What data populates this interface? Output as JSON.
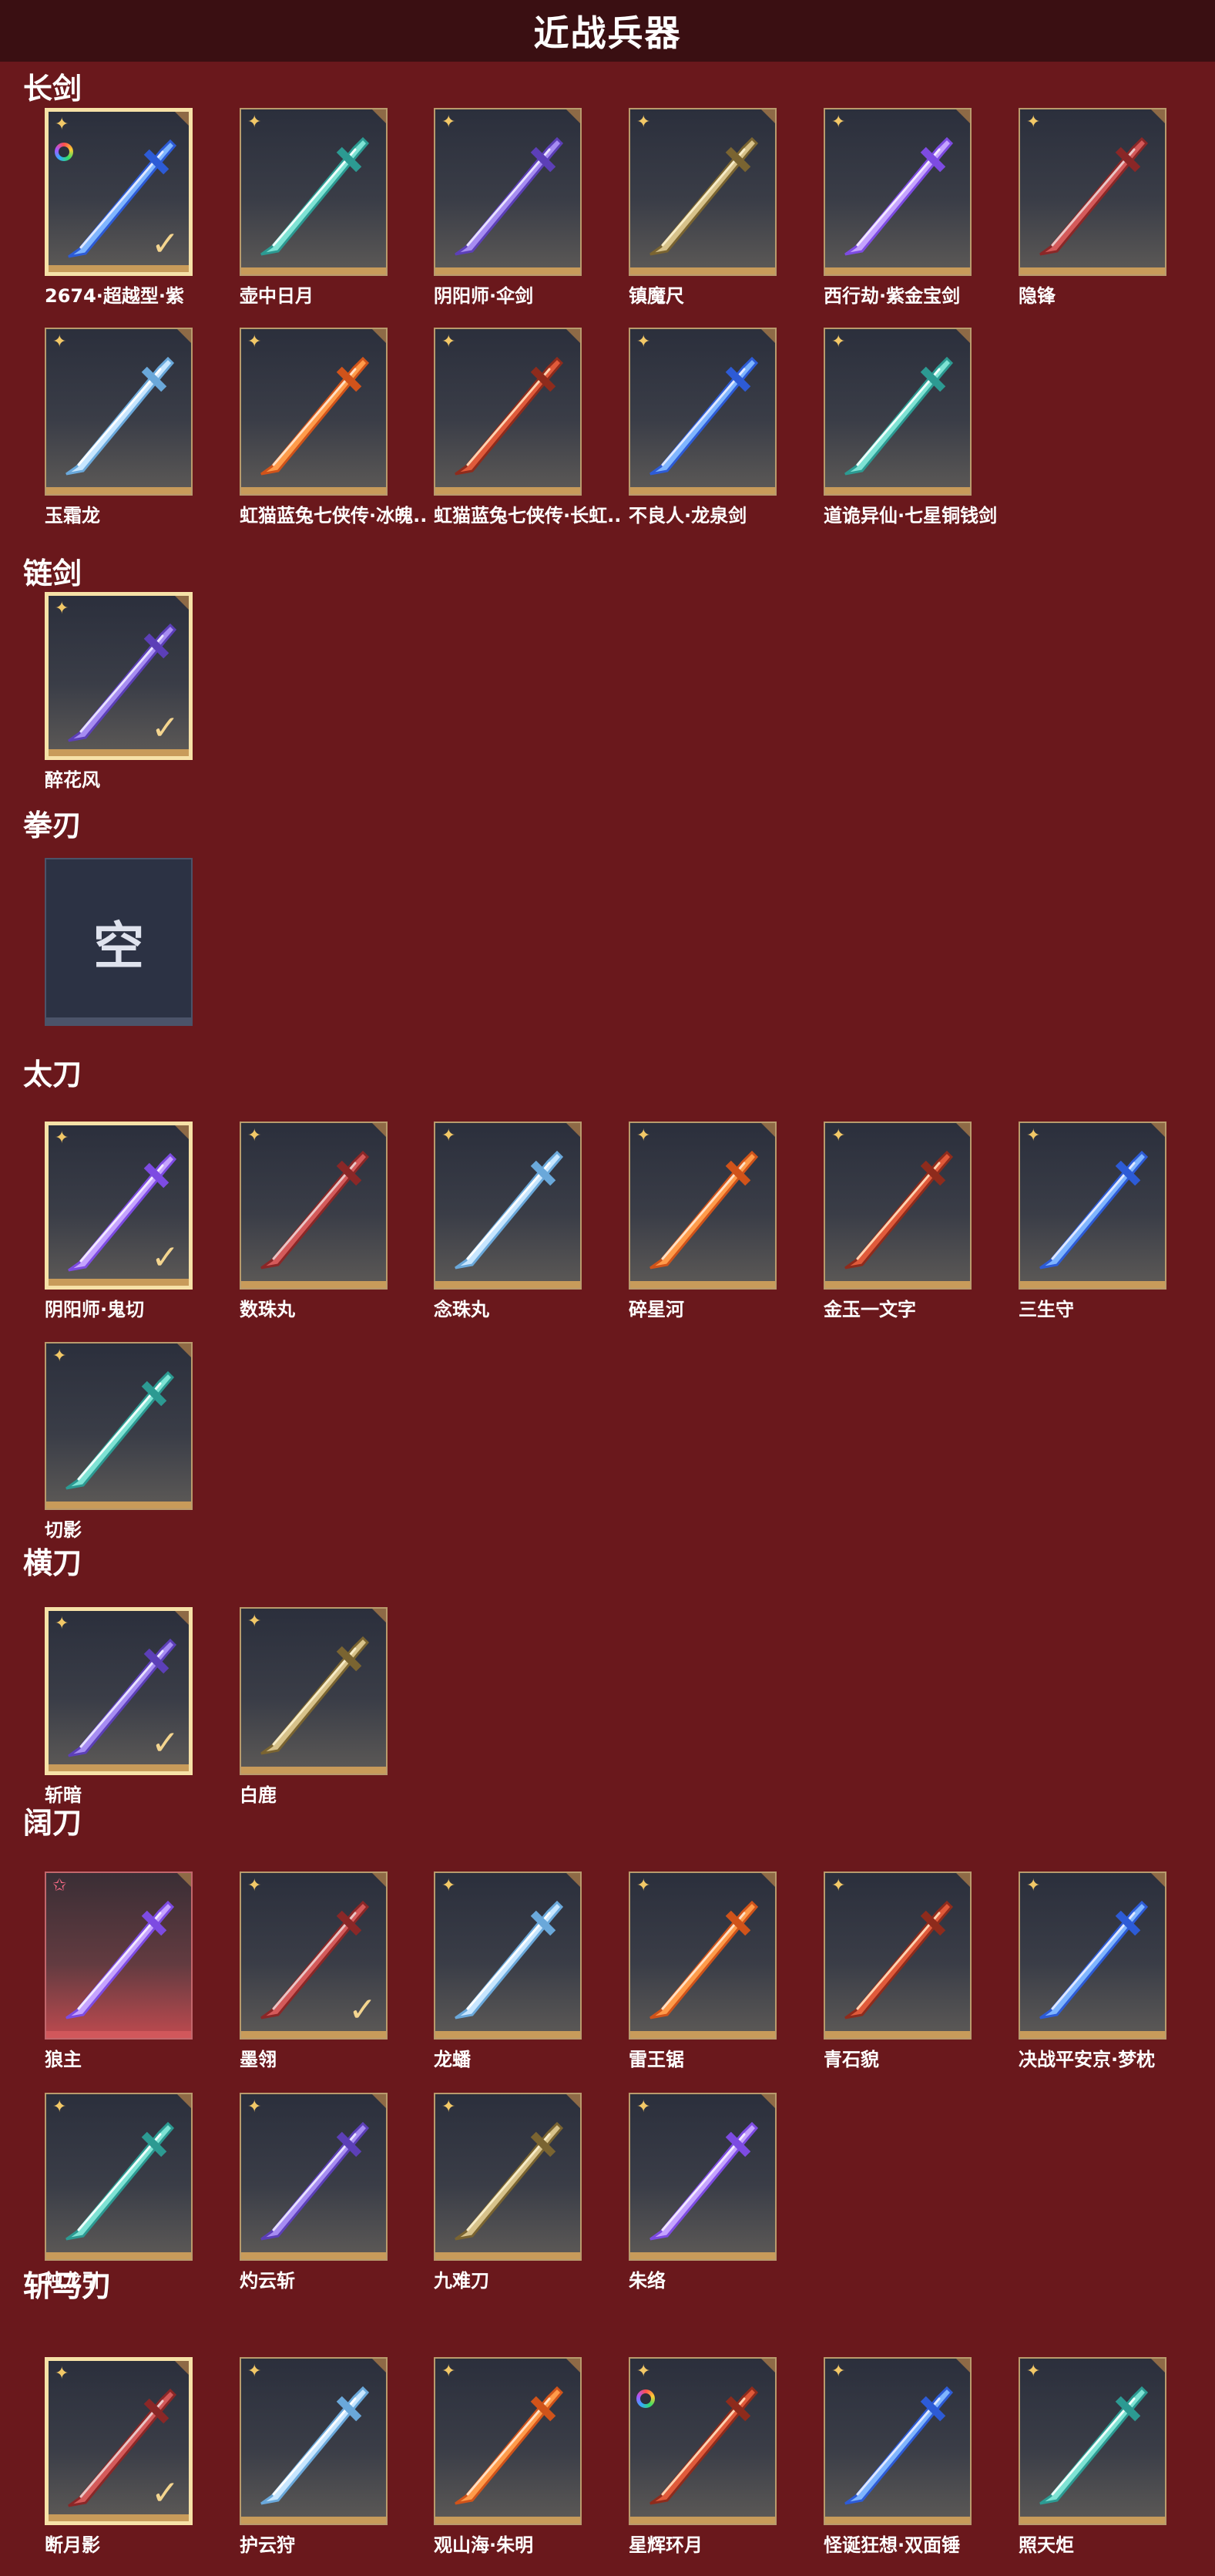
{
  "page": {
    "title": "近战兵器"
  },
  "sections": [
    {
      "name": "长剑",
      "items": [
        {
          "label": "2674·超越型·紫",
          "selected": true,
          "ring": true,
          "rarity": "gold"
        },
        {
          "label": "壶中日月",
          "selected": false,
          "rarity": "gold"
        },
        {
          "label": "阴阳师·伞剑",
          "selected": false,
          "rarity": "gold"
        },
        {
          "label": "镇魔尺",
          "selected": false,
          "rarity": "gold"
        },
        {
          "label": "西行劫·紫金宝剑",
          "selected": false,
          "rarity": "gold"
        },
        {
          "label": "隐锋",
          "selected": false,
          "rarity": "gold"
        },
        {
          "label": "玉霜龙",
          "selected": false,
          "rarity": "gold"
        },
        {
          "label": "虹猫蓝兔七侠传·冰魄..",
          "selected": false,
          "rarity": "gold"
        },
        {
          "label": "虹猫蓝兔七侠传·长虹..",
          "selected": false,
          "rarity": "gold"
        },
        {
          "label": "不良人·龙泉剑",
          "selected": false,
          "rarity": "gold"
        },
        {
          "label": "道诡异仙·七星铜钱剑",
          "selected": false,
          "rarity": "gold"
        }
      ]
    },
    {
      "name": "链剑",
      "items": [
        {
          "label": "醉花风",
          "selected": true,
          "rarity": "gold"
        }
      ]
    },
    {
      "name": "拳刃",
      "items": [
        {
          "label": "",
          "empty": true,
          "empty_text": "空"
        }
      ]
    },
    {
      "name": "太刀",
      "items": [
        {
          "label": "阴阳师·鬼切",
          "selected": true,
          "rarity": "gold"
        },
        {
          "label": "数珠丸",
          "selected": false,
          "rarity": "gold"
        },
        {
          "label": "念珠丸",
          "selected": false,
          "rarity": "gold"
        },
        {
          "label": "碎星河",
          "selected": false,
          "rarity": "gold"
        },
        {
          "label": "金玉一文字",
          "selected": false,
          "rarity": "gold"
        },
        {
          "label": "三生守",
          "selected": false,
          "rarity": "gold"
        },
        {
          "label": "切影",
          "selected": false,
          "rarity": "gold"
        }
      ]
    },
    {
      "name": "横刀",
      "items": [
        {
          "label": "斩暗",
          "selected": true,
          "rarity": "gold"
        },
        {
          "label": "白鹿",
          "selected": false,
          "rarity": "gold"
        }
      ]
    },
    {
      "name": "阔刀",
      "items": [
        {
          "label": "狼主",
          "selected": false,
          "rarity": "red"
        },
        {
          "label": "墨翎",
          "selected": false,
          "checked": true,
          "rarity": "gold"
        },
        {
          "label": "龙蟠",
          "selected": false,
          "rarity": "gold"
        },
        {
          "label": "雷王锯",
          "selected": false,
          "rarity": "gold"
        },
        {
          "label": "青石貌",
          "selected": false,
          "rarity": "gold"
        },
        {
          "label": "决战平安京·梦枕",
          "selected": false,
          "rarity": "gold"
        },
        {
          "label": "烛龙引",
          "selected": false,
          "rarity": "gold"
        },
        {
          "label": "灼云斩",
          "selected": false,
          "rarity": "gold"
        },
        {
          "label": "九难刀",
          "selected": false,
          "rarity": "gold"
        },
        {
          "label": "朱络",
          "selected": false,
          "rarity": "gold"
        }
      ]
    },
    {
      "name": "斩马刀",
      "items": [
        {
          "label": "断月影",
          "selected": true,
          "rarity": "gold"
        },
        {
          "label": "护云狩",
          "selected": false,
          "rarity": "gold"
        },
        {
          "label": "观山海·朱明",
          "selected": false,
          "rarity": "gold"
        },
        {
          "label": "星辉环月",
          "selected": false,
          "ring": true,
          "rarity": "gold"
        },
        {
          "label": "怪诞狂想·双面锤",
          "selected": false,
          "rarity": "gold"
        },
        {
          "label": "照天炬",
          "selected": false,
          "rarity": "gold"
        }
      ]
    }
  ],
  "icons": {
    "rarity": "star-badge-icon",
    "selected": "checkmark-icon",
    "ring": "color-ring-icon"
  },
  "colors": {
    "background": "#6a181c",
    "header": "#3a0f12",
    "gold": "#c89b5a",
    "red_rarity": "#d1575b"
  }
}
